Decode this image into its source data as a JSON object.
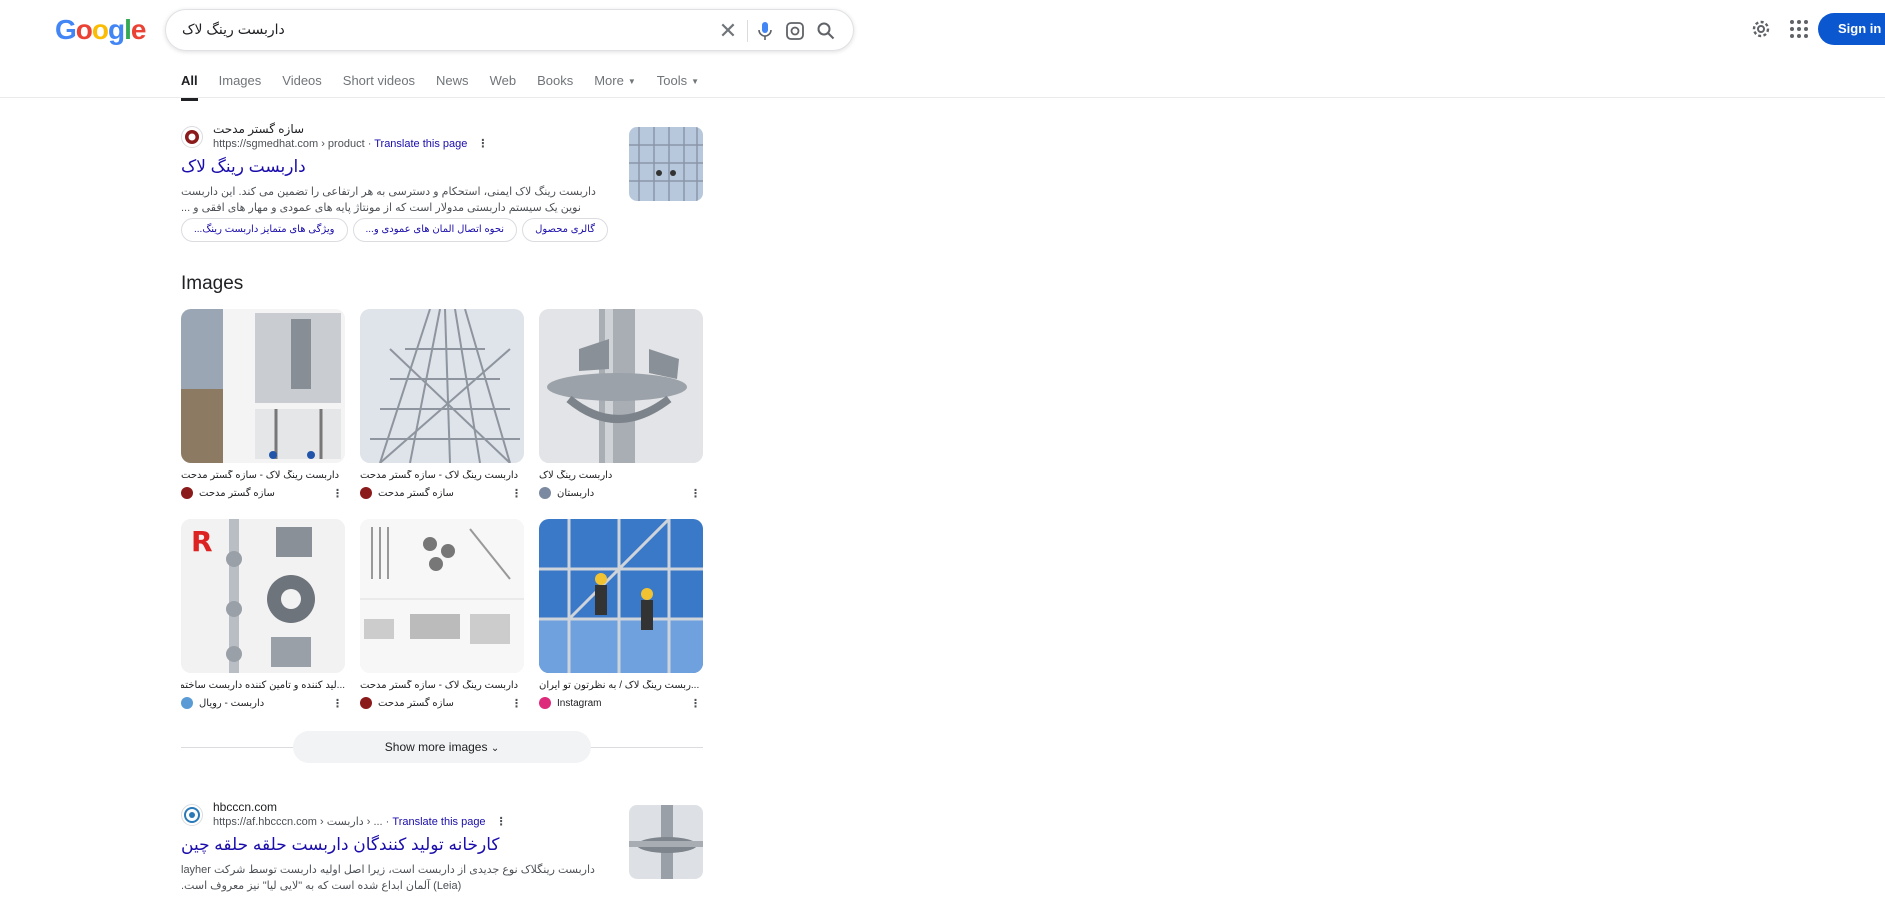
{
  "header": {
    "logo": [
      "G",
      "o",
      "o",
      "g",
      "l",
      "e"
    ],
    "query": "داربست رینگ لاک",
    "clear_glyph": "✕",
    "signin_label": "Sign in"
  },
  "tabs": [
    {
      "label": "All",
      "active": true
    },
    {
      "label": "Images"
    },
    {
      "label": "Videos"
    },
    {
      "label": "Short videos"
    },
    {
      "label": "News"
    },
    {
      "label": "Web"
    },
    {
      "label": "Books"
    },
    {
      "label": "More",
      "caret": true
    },
    {
      "label": "Tools",
      "caret": true
    }
  ],
  "result1": {
    "site_name": "سازه گستر مدحت",
    "url": "https://sgmedhat.com › product",
    "translate": "Translate this page",
    "title": "داربست رینگ لاک",
    "snippet": "داربست رینگ لاک ایمنی، استحکام و دسترسی به هر ارتفاعی را تضمین می کند. این داربست نوین یک سیستم داربستی مدولار است که از مونتاژ پایه های عمودی و مهار های افقی و ...",
    "chips": [
      "گالری محصول",
      "نحوه اتصال المان های عمودی و...",
      "ویژگی های متمایز داربست رینگ..."
    ]
  },
  "images_section": {
    "heading": "Images",
    "cards": [
      {
        "caption": "داربست رینگ لاک - سازه گستر مدحت",
        "source": "سازه گستر مدحت"
      },
      {
        "caption": "داربست رینگ لاک - سازه گستر مدحت",
        "source": "سازه گستر مدحت"
      },
      {
        "caption": "داربست رینگ لاک",
        "source": "داربستان"
      },
      {
        "caption": "...لید کننده و تامین کننده داربست ساختمانی د",
        "source": "داربست - رویال"
      },
      {
        "caption": "داربست رینگ لاک - سازه گستر مدحت",
        "source": "سازه گستر مدحت"
      },
      {
        "caption": "...ربست رینگ لاک / به نظرتون تو ایران",
        "source": "Instagram"
      }
    ],
    "show_more": "Show more images"
  },
  "result2": {
    "site_name": "hbcccn.com",
    "url": "https://af.hbcccn.com › داربست › ...",
    "translate": "Translate this page",
    "title": "کارخانه تولید کنندگان داربست حلقه حلقه چین",
    "snippet": "داربست رینگلاک نوع جدیدی از داربست است، زیرا اصل اولیه داربست توسط شرکت layher (Leia) آلمان ابداع شده است که به \"لایی لیا\" نیز معروف است."
  },
  "colors": {
    "link": "#1a0dab",
    "accent": "#0b57d0",
    "text": "#202124",
    "muted": "#70757a"
  }
}
